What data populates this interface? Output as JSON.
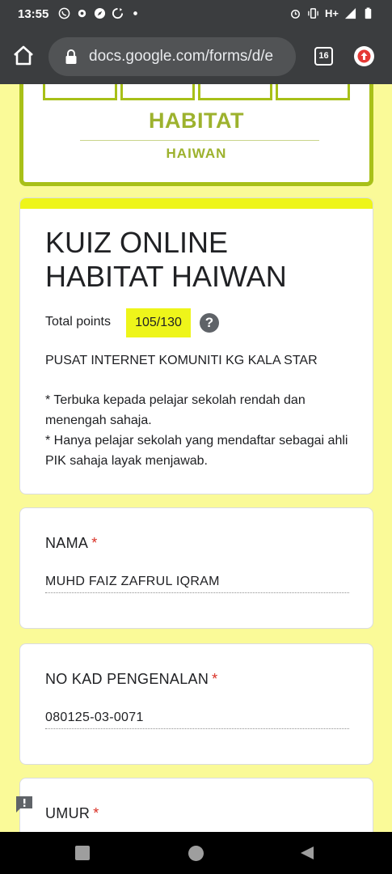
{
  "status_bar": {
    "time": "13:55",
    "network": "H+"
  },
  "browser": {
    "url": "docs.google.com/forms/d/e",
    "tab_count": "16"
  },
  "banner": {
    "title": "HABITAT",
    "subtitle": "HAIWAN"
  },
  "form": {
    "title": "KUIZ ONLINE HABITAT HAIWAN",
    "points_label": "Total points",
    "points_value": "105/130",
    "help_symbol": "?",
    "org": "PUSAT INTERNET KOMUNITI KG KALA STAR",
    "note1": "* Terbuka kepada pelajar sekolah rendah dan menengah sahaja.",
    "note2": "* Hanya pelajar sekolah yang mendaftar sebagai ahli PIK sahaja layak menjawab."
  },
  "questions": [
    {
      "label": "NAMA",
      "required_mark": "*",
      "answer": "MUHD FAIZ ZAFRUL IQRAM"
    },
    {
      "label": "NO KAD PENGENALAN",
      "required_mark": "*",
      "answer": "080125-03-0071"
    },
    {
      "label": "UMUR",
      "required_mark": "*"
    }
  ],
  "colors": {
    "page_bg": "#fafa98",
    "accent": "#eef51a",
    "banner_green": "#a8c018",
    "required": "#d93025"
  }
}
